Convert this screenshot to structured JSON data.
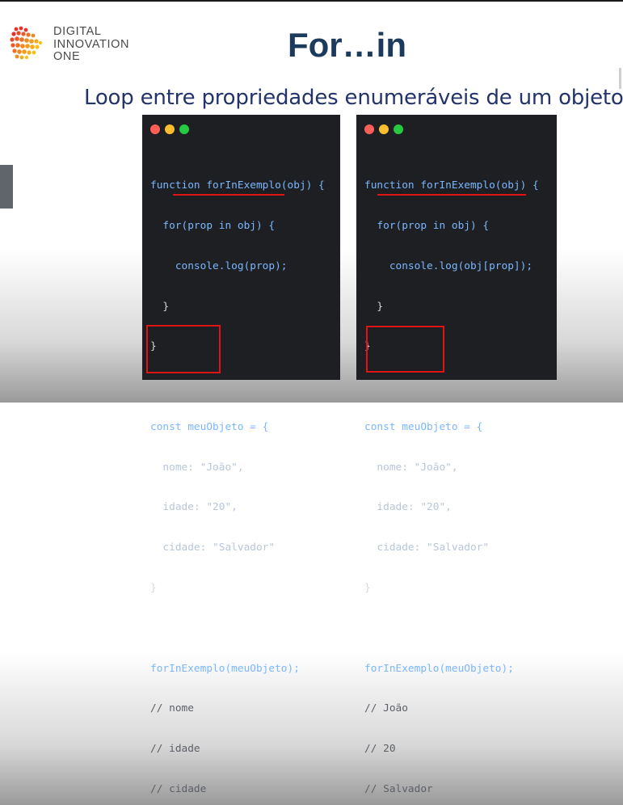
{
  "logo": {
    "line1": "DIGITAL",
    "line2": "INNOVATION",
    "line3": "ONE",
    "colors": [
      "#e6332a",
      "#f18a1f",
      "#f6c21a"
    ]
  },
  "slide": {
    "title": "For…in",
    "subtitle": "Loop entre propriedades enumeráveis de um objeto."
  },
  "left_panel": {
    "function_line": "function forInExemplo(obj) {",
    "for_line": "  for(prop in obj) {",
    "log_line": "    console.log(prop);",
    "close_inner": "  }",
    "close_outer": "}",
    "const_line": "const meuObjeto = {",
    "prop1": "  nome: \"João\",",
    "prop2": "  idade: \"20\",",
    "prop3": "  cidade: \"Salvador\"",
    "close_obj": "}",
    "call_line": "forInExemplo(meuObjeto);",
    "output": [
      "// nome",
      "// idade",
      "// cidade"
    ]
  },
  "right_panel": {
    "function_line": "function forInExemplo(obj) {",
    "for_line": "  for(prop in obj) {",
    "log_line": "    console.log(obj[prop]);",
    "close_inner": "  }",
    "close_outer": "}",
    "const_line": "const meuObjeto = {",
    "prop1": "  nome: \"João\",",
    "prop2": "  idade: \"20\",",
    "prop3": "  cidade: \"Salvador\"",
    "close_obj": "}",
    "call_line": "forInExemplo(meuObjeto);",
    "output": [
      "// João",
      "// 20",
      "// Salvador"
    ]
  },
  "colors": {
    "title": "#1b3a5c",
    "subtitle": "#23336b",
    "highlight": "#e01414",
    "code_bg": "#1e1f22"
  }
}
